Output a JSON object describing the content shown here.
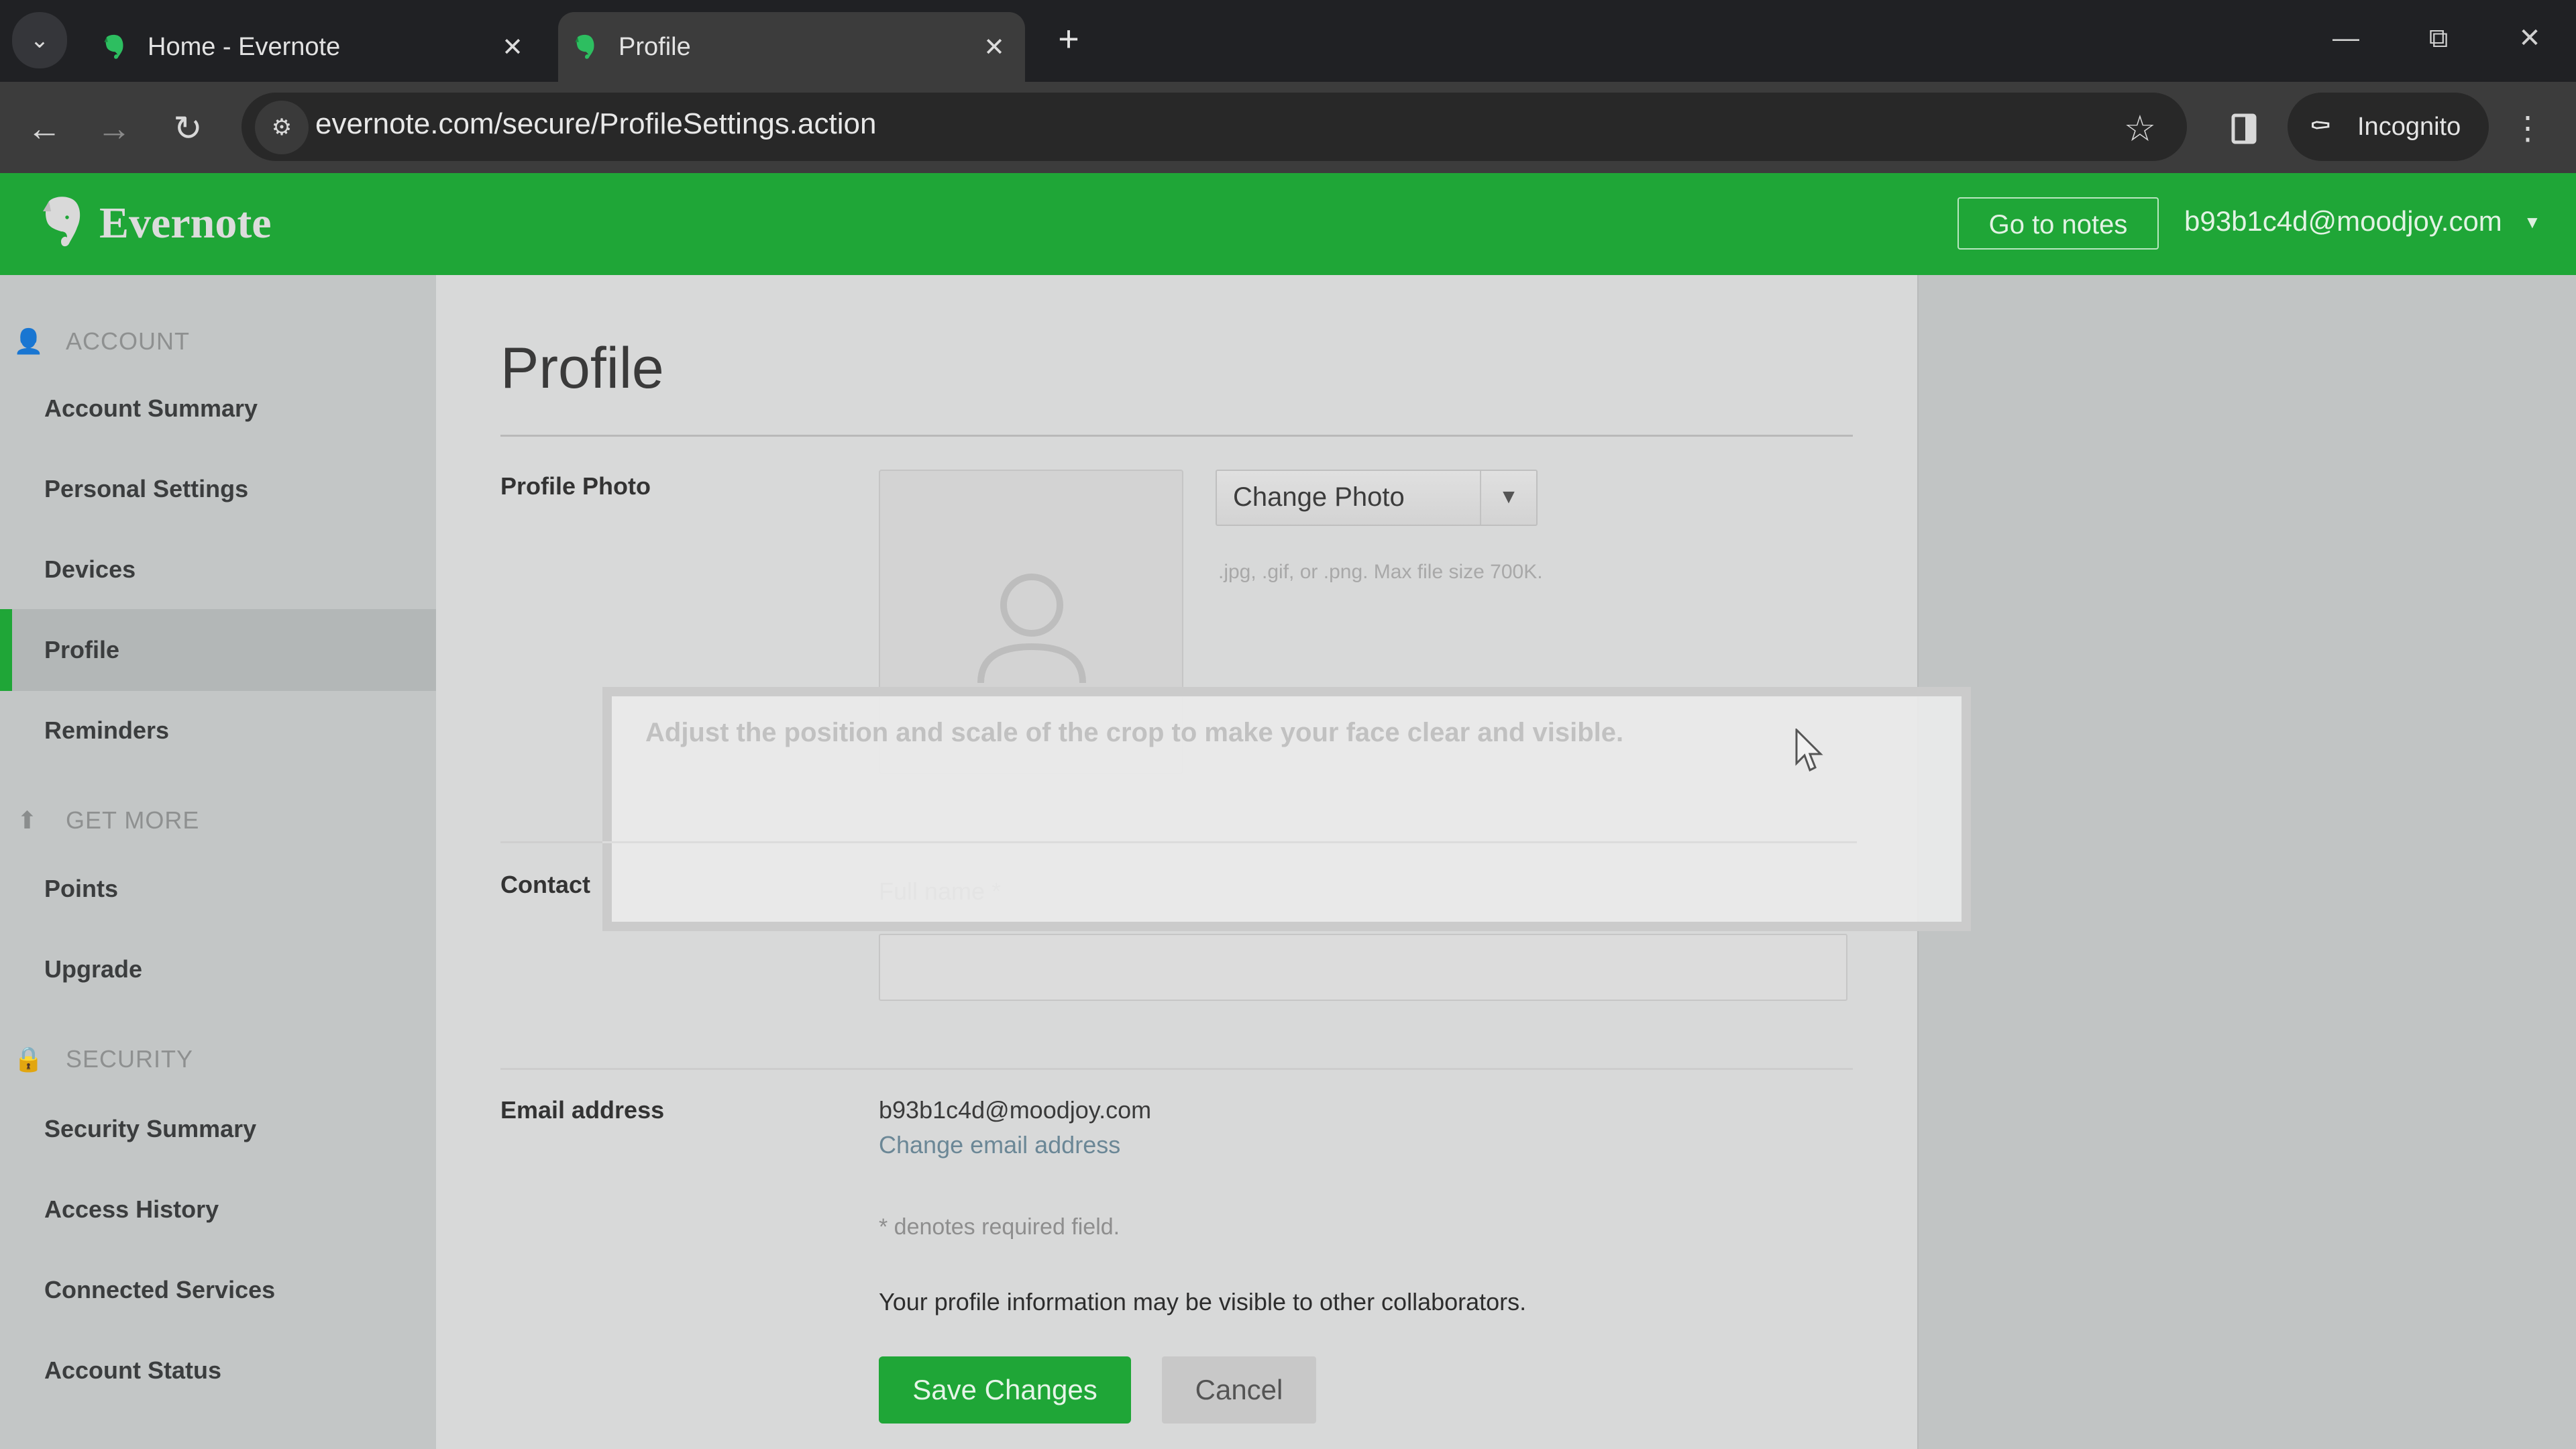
{
  "browser": {
    "tabs": [
      {
        "title": "Home - Evernote",
        "active": false
      },
      {
        "title": "Profile",
        "active": true
      }
    ],
    "new_tab_icon": "plus-icon",
    "url": "evernote.com/secure/ProfileSettings.action",
    "incognito_label": "Incognito",
    "window_controls": [
      "minimize-icon",
      "restore-icon",
      "close-icon"
    ]
  },
  "header": {
    "brand": "Evernote",
    "go_to_notes": "Go to notes",
    "user_email": "b93b1c4d@moodjoy.com",
    "accent_color": "#1fa637"
  },
  "sidebar": {
    "sections": [
      {
        "title": "ACCOUNT",
        "icon": "user-icon",
        "items": [
          {
            "label": "Account Summary",
            "active": false
          },
          {
            "label": "Personal Settings",
            "active": false
          },
          {
            "label": "Devices",
            "active": false
          },
          {
            "label": "Profile",
            "active": true
          },
          {
            "label": "Reminders",
            "active": false
          }
        ]
      },
      {
        "title": "GET MORE",
        "icon": "arrow-up-icon",
        "items": [
          {
            "label": "Points",
            "active": false
          },
          {
            "label": "Upgrade",
            "active": false
          }
        ]
      },
      {
        "title": "SECURITY",
        "icon": "lock-icon",
        "items": [
          {
            "label": "Security Summary",
            "active": false
          },
          {
            "label": "Access History",
            "active": false
          },
          {
            "label": "Connected Services",
            "active": false
          },
          {
            "label": "Account Status",
            "active": false
          }
        ]
      }
    ]
  },
  "main": {
    "title": "Profile",
    "profile_photo": {
      "label": "Profile Photo",
      "change_button": "Change Photo",
      "hint": ".jpg, .gif, or .png. Max file size 700K."
    },
    "contact": {
      "label": "Contact",
      "full_name_label": "Full name",
      "required_mark": "*",
      "full_name_value": ""
    },
    "email": {
      "label": "Email address",
      "value": "b93b1c4d@moodjoy.com",
      "change_link": "Change email address"
    },
    "required_note": "* denotes required field.",
    "visibility_note": "Your profile information may be visible to other collaborators.",
    "save_button": "Save Changes",
    "cancel_button": "Cancel"
  },
  "tooltip": {
    "text": "Adjust the position and scale of the crop to make your face clear and visible."
  }
}
